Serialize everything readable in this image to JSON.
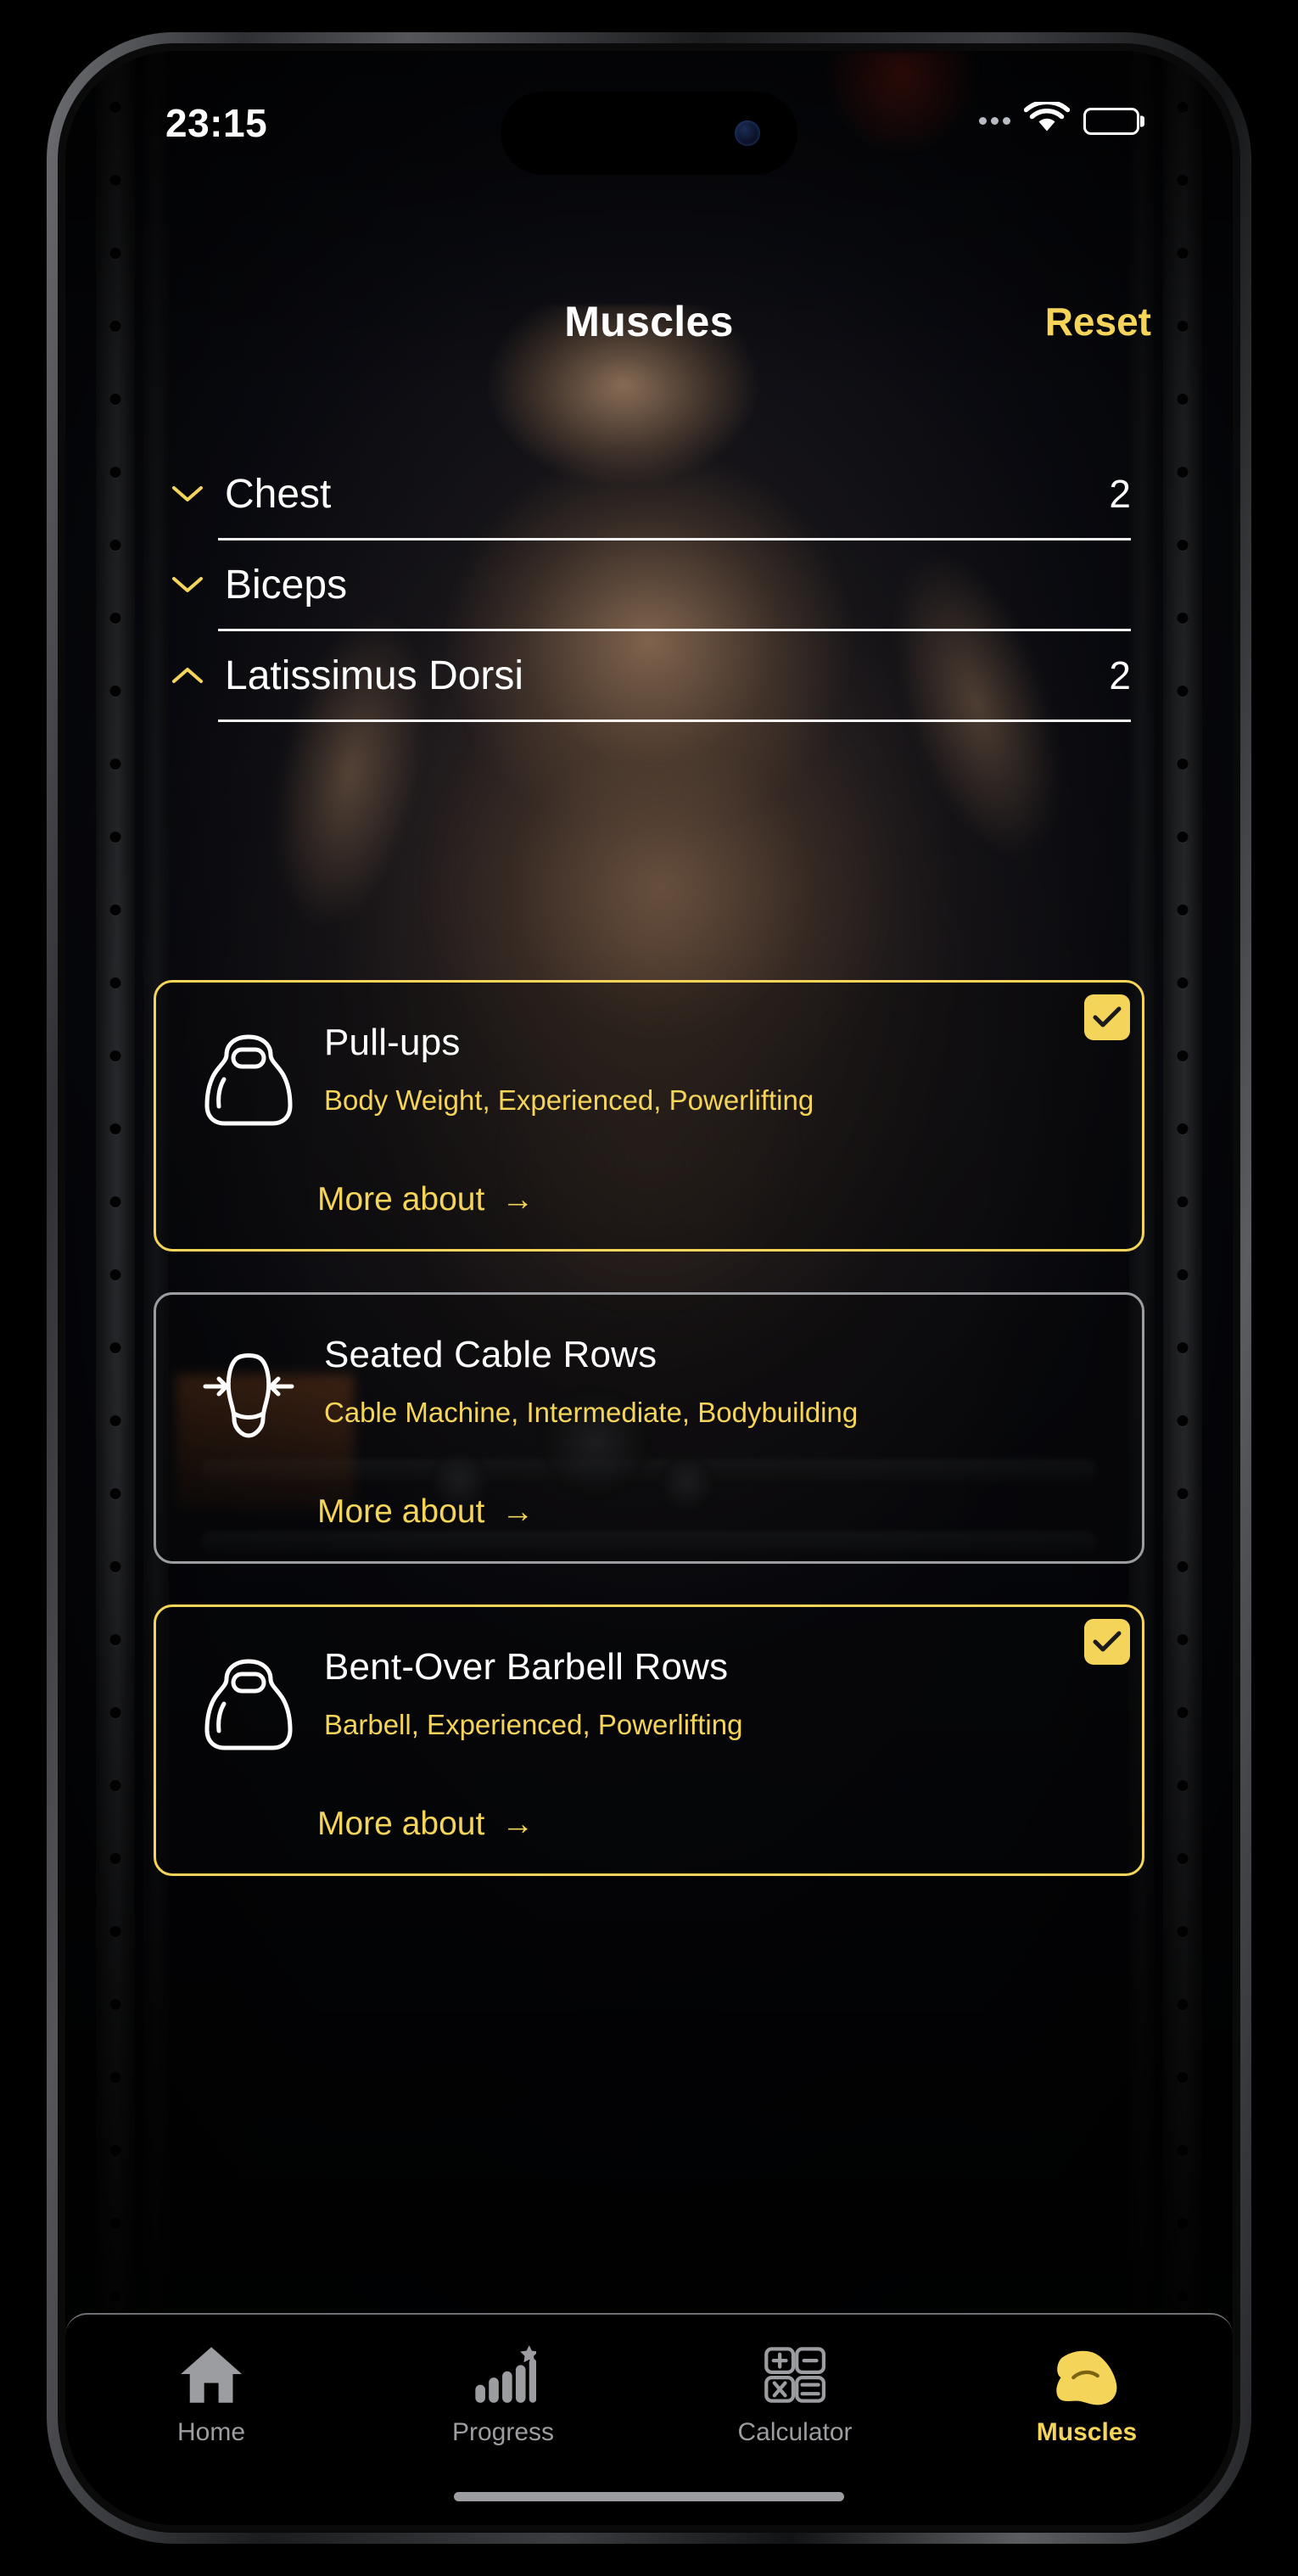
{
  "status_bar": {
    "time": "23:15",
    "signal_icon": "signal-dots-icon",
    "wifi_icon": "wifi-icon",
    "battery_icon": "battery-icon"
  },
  "header": {
    "title": "Muscles",
    "reset_label": "Reset"
  },
  "muscle_groups": [
    {
      "name": "Chest",
      "count": "2",
      "expanded": false,
      "chevron": "chevron-down-icon"
    },
    {
      "name": "Biceps",
      "count": "",
      "expanded": false,
      "chevron": "chevron-down-icon"
    },
    {
      "name": "Latissimus Dorsi",
      "count": "2",
      "expanded": true,
      "chevron": "chevron-up-icon"
    }
  ],
  "exercises": [
    {
      "title": "Pull-ups",
      "meta": "Body Weight, Experienced, Powerlifting",
      "more_label": "More about",
      "more_arrow": "→",
      "selected": true,
      "icon": "kettlebell-icon"
    },
    {
      "title": "Seated Cable Rows",
      "meta": "Cable Machine, Intermediate, Bodybuilding",
      "more_label": "More about",
      "more_arrow": "→",
      "selected": false,
      "icon": "back-muscle-icon"
    },
    {
      "title": "Bent-Over Barbell Rows",
      "meta": "Barbell, Experienced, Powerlifting",
      "more_label": "More about",
      "more_arrow": "→",
      "selected": true,
      "icon": "kettlebell-icon"
    }
  ],
  "tab_bar": [
    {
      "label": "Home",
      "icon": "home-icon",
      "active": false
    },
    {
      "label": "Progress",
      "icon": "bar-chart-star-icon",
      "active": false
    },
    {
      "label": "Calculator",
      "icon": "calculator-icon",
      "active": false
    },
    {
      "label": "Muscles",
      "icon": "flexed-biceps-icon",
      "active": true
    }
  ],
  "colors": {
    "accent": "#F5D45A",
    "text_primary": "#FFFFFF",
    "text_muted": "#9B9DA1",
    "background": "#000000"
  }
}
